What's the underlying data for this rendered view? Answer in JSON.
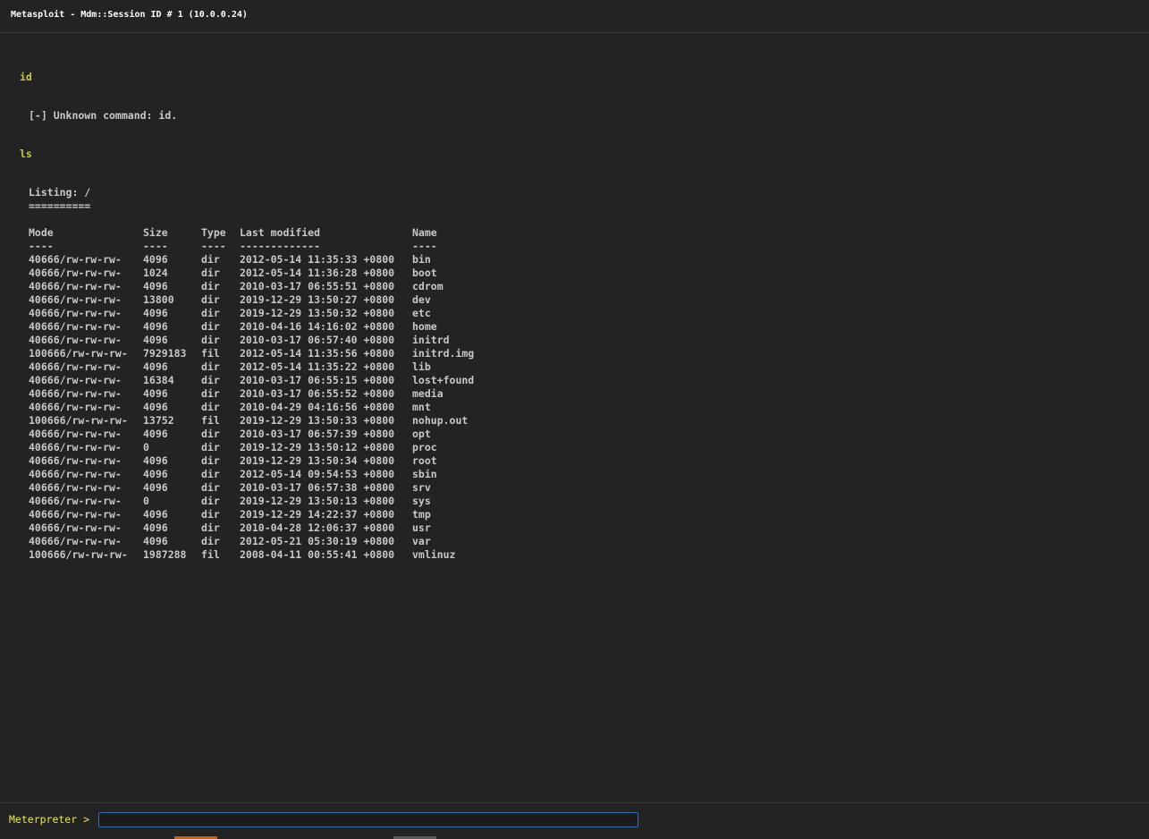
{
  "window": {
    "title": "Metasploit - Mdm::Session ID # 1 (10.0.0.24)"
  },
  "console": {
    "cmd1": "id",
    "out1": "[-] Unknown command: id.",
    "cmd2": "ls",
    "listing_title": "Listing: /",
    "listing_underline": "==========",
    "headers": {
      "mode": "Mode",
      "size": "Size",
      "type": "Type",
      "modified": "Last modified",
      "name": "Name"
    },
    "header_rules": {
      "mode": "----",
      "size": "----",
      "type": "----",
      "modified": "-------------",
      "name": "----"
    },
    "rows": [
      {
        "mode": "40666/rw-rw-rw-",
        "size": "4096",
        "type": "dir",
        "modified": "2012-05-14 11:35:33 +0800",
        "name": "bin"
      },
      {
        "mode": "40666/rw-rw-rw-",
        "size": "1024",
        "type": "dir",
        "modified": "2012-05-14 11:36:28 +0800",
        "name": "boot"
      },
      {
        "mode": "40666/rw-rw-rw-",
        "size": "4096",
        "type": "dir",
        "modified": "2010-03-17 06:55:51 +0800",
        "name": "cdrom"
      },
      {
        "mode": "40666/rw-rw-rw-",
        "size": "13800",
        "type": "dir",
        "modified": "2019-12-29 13:50:27 +0800",
        "name": "dev"
      },
      {
        "mode": "40666/rw-rw-rw-",
        "size": "4096",
        "type": "dir",
        "modified": "2019-12-29 13:50:32 +0800",
        "name": "etc"
      },
      {
        "mode": "40666/rw-rw-rw-",
        "size": "4096",
        "type": "dir",
        "modified": "2010-04-16 14:16:02 +0800",
        "name": "home"
      },
      {
        "mode": "40666/rw-rw-rw-",
        "size": "4096",
        "type": "dir",
        "modified": "2010-03-17 06:57:40 +0800",
        "name": "initrd"
      },
      {
        "mode": "100666/rw-rw-rw-",
        "size": "7929183",
        "type": "fil",
        "modified": "2012-05-14 11:35:56 +0800",
        "name": "initrd.img"
      },
      {
        "mode": "40666/rw-rw-rw-",
        "size": "4096",
        "type": "dir",
        "modified": "2012-05-14 11:35:22 +0800",
        "name": "lib"
      },
      {
        "mode": "40666/rw-rw-rw-",
        "size": "16384",
        "type": "dir",
        "modified": "2010-03-17 06:55:15 +0800",
        "name": "lost+found"
      },
      {
        "mode": "40666/rw-rw-rw-",
        "size": "4096",
        "type": "dir",
        "modified": "2010-03-17 06:55:52 +0800",
        "name": "media"
      },
      {
        "mode": "40666/rw-rw-rw-",
        "size": "4096",
        "type": "dir",
        "modified": "2010-04-29 04:16:56 +0800",
        "name": "mnt"
      },
      {
        "mode": "100666/rw-rw-rw-",
        "size": "13752",
        "type": "fil",
        "modified": "2019-12-29 13:50:33 +0800",
        "name": "nohup.out"
      },
      {
        "mode": "40666/rw-rw-rw-",
        "size": "4096",
        "type": "dir",
        "modified": "2010-03-17 06:57:39 +0800",
        "name": "opt"
      },
      {
        "mode": "40666/rw-rw-rw-",
        "size": "0",
        "type": "dir",
        "modified": "2019-12-29 13:50:12 +0800",
        "name": "proc"
      },
      {
        "mode": "40666/rw-rw-rw-",
        "size": "4096",
        "type": "dir",
        "modified": "2019-12-29 13:50:34 +0800",
        "name": "root"
      },
      {
        "mode": "40666/rw-rw-rw-",
        "size": "4096",
        "type": "dir",
        "modified": "2012-05-14 09:54:53 +0800",
        "name": "sbin"
      },
      {
        "mode": "40666/rw-rw-rw-",
        "size": "4096",
        "type": "dir",
        "modified": "2010-03-17 06:57:38 +0800",
        "name": "srv"
      },
      {
        "mode": "40666/rw-rw-rw-",
        "size": "0",
        "type": "dir",
        "modified": "2019-12-29 13:50:13 +0800",
        "name": "sys"
      },
      {
        "mode": "40666/rw-rw-rw-",
        "size": "4096",
        "type": "dir",
        "modified": "2019-12-29 14:22:37 +0800",
        "name": "tmp"
      },
      {
        "mode": "40666/rw-rw-rw-",
        "size": "4096",
        "type": "dir",
        "modified": "2010-04-28 12:06:37 +0800",
        "name": "usr"
      },
      {
        "mode": "40666/rw-rw-rw-",
        "size": "4096",
        "type": "dir",
        "modified": "2012-05-21 05:30:19 +0800",
        "name": "var"
      },
      {
        "mode": "100666/rw-rw-rw-",
        "size": "1987288",
        "type": "fil",
        "modified": "2008-04-11 00:55:41 +0800",
        "name": "vmlinuz"
      }
    ]
  },
  "prompt": {
    "label": "Meterpreter >",
    "value": ""
  },
  "colors": {
    "background": "#232323",
    "command": "#c8c84a",
    "output": "#c8c8c8",
    "prompt": "#e8e84a",
    "input_border": "#3d6bb0"
  }
}
